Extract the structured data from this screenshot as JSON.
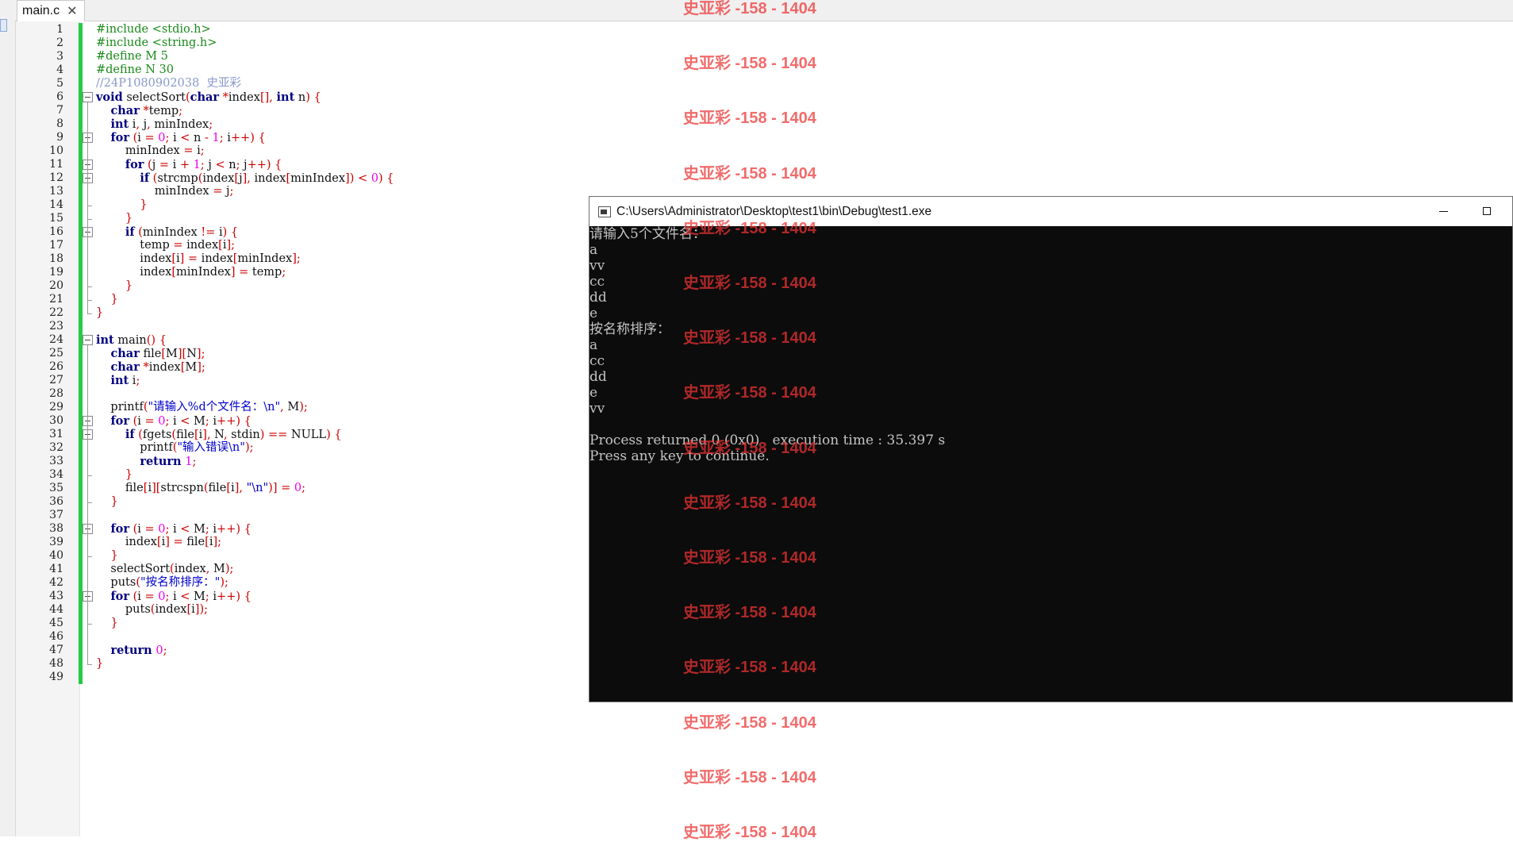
{
  "editor": {
    "tab_label": "main.c",
    "tab_close": "✕",
    "line_numbers": [
      "1",
      "2",
      "3",
      "4",
      "5",
      "6",
      "7",
      "8",
      "9",
      "10",
      "11",
      "12",
      "13",
      "14",
      "15",
      "16",
      "17",
      "18",
      "19",
      "20",
      "21",
      "22",
      "23",
      "24",
      "25",
      "26",
      "27",
      "28",
      "29",
      "30",
      "31",
      "32",
      "33",
      "34",
      "35",
      "36",
      "37",
      "38",
      "39",
      "40",
      "41",
      "42",
      "43",
      "44",
      "45",
      "46",
      "47",
      "48",
      "49"
    ],
    "code_lines": [
      "#include <stdio.h>",
      "#include <string.h>",
      "#define M 5",
      "#define N 30",
      "//24P1080902038  史亚彩",
      "void selectSort(char *index[], int n) {",
      "    char *temp;",
      "    int i, j, minIndex;",
      "    for (i = 0; i < n - 1; i++) {",
      "        minIndex = i;",
      "        for (j = i + 1; j < n; j++) {",
      "            if (strcmp(index[j], index[minIndex]) < 0) {",
      "                minIndex = j;",
      "            }",
      "        }",
      "        if (minIndex != i) {",
      "            temp = index[i];",
      "            index[i] = index[minIndex];",
      "            index[minIndex] = temp;",
      "        }",
      "    }",
      "}",
      "",
      "int main() {",
      "    char file[M][N];",
      "    char *index[M];",
      "    int i;",
      "",
      "    printf(\"请输入%d个文件名：\\n\", M);",
      "    for (i = 0; i < M; i++) {",
      "        if (fgets(file[i], N, stdin) == NULL) {",
      "            printf(\"输入错误\\n\");",
      "            return 1;",
      "        }",
      "        file[i][strcspn(file[i], \"\\n\")] = 0;",
      "    }",
      "",
      "    for (i = 0; i < M; i++) {",
      "        index[i] = file[i];",
      "    }",
      "    selectSort(index, M);",
      "    puts(\"按名称排序：\");",
      "    for (i = 0; i < M; i++) {",
      "        puts(index[i]);",
      "    }",
      "",
      "    return 0;",
      "}",
      ""
    ]
  },
  "console": {
    "title": "C:\\Users\\Administrator\\Desktop\\test1\\bin\\Debug\\test1.exe",
    "lines": [
      "请输入5个文件名：",
      "a",
      "vv",
      "cc",
      "dd",
      "e",
      "按名称排序：",
      "a",
      "cc",
      "dd",
      "e",
      "vv",
      "",
      "Process returned 0 (0x0)   execution time : 35.397 s",
      "Press any key to continue."
    ]
  },
  "watermark": {
    "text": "史亚彩 -158 - 1404",
    "count": 16
  },
  "colors": {
    "keyword": "#000080",
    "preprocessor": "#1a8a1a",
    "comment": "#8899cc",
    "string": "#0000cc",
    "number": "#ee00ee",
    "operator": "#cc0000",
    "changebar": "#22cc44",
    "console_bg": "#0c0c0c",
    "console_fg": "#c4c4c4",
    "watermark": "#ee3333"
  }
}
